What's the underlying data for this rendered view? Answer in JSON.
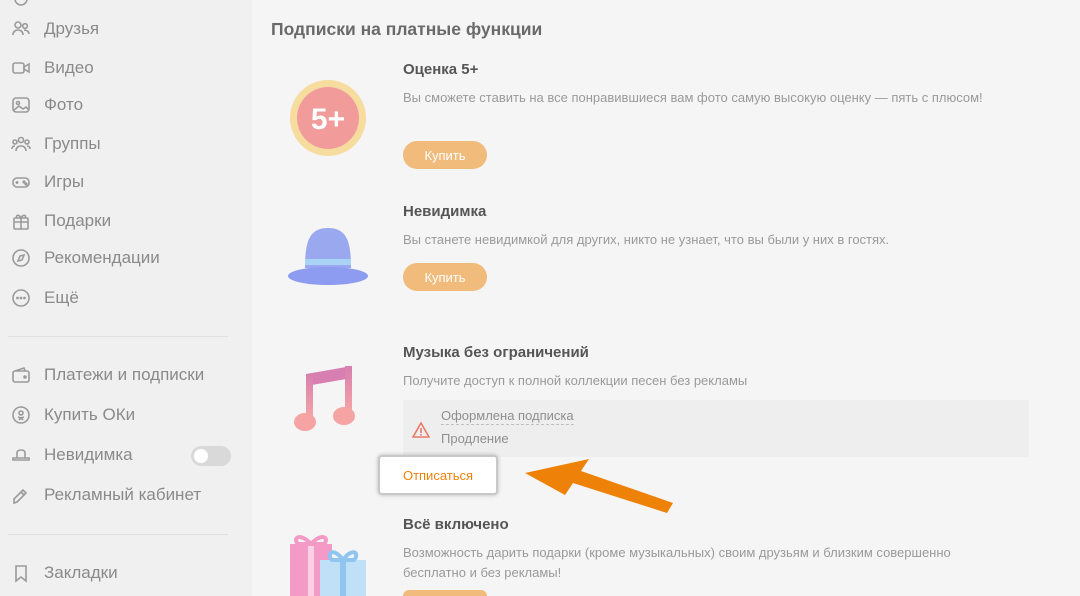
{
  "sidebar": {
    "items": [
      {
        "label": "Друзья",
        "icon": "friends-icon"
      },
      {
        "label": "Видео",
        "icon": "video-icon"
      },
      {
        "label": "Фото",
        "icon": "photo-icon"
      },
      {
        "label": "Группы",
        "icon": "groups-icon"
      },
      {
        "label": "Игры",
        "icon": "games-icon"
      },
      {
        "label": "Подарки",
        "icon": "gift-icon"
      },
      {
        "label": "Рекомендации",
        "icon": "compass-icon"
      },
      {
        "label": "Ещё",
        "icon": "more-icon"
      }
    ],
    "items2": [
      {
        "label": "Платежи и подписки",
        "icon": "wallet-icon"
      },
      {
        "label": "Купить ОКи",
        "icon": "ok-coin-icon"
      },
      {
        "label": "Невидимка",
        "icon": "hat-icon"
      },
      {
        "label": "Рекламный кабинет",
        "icon": "megaphone-icon"
      }
    ],
    "items3": [
      {
        "label": "Закладки",
        "icon": "bookmark-icon"
      }
    ],
    "invisible_toggle_on": false
  },
  "main": {
    "section_title": "Подписки на платные функции",
    "features": [
      {
        "title": "Оценка 5+",
        "badge": "5+",
        "description": "Вы сможете ставить на все понравившиеся вам фото самую высокую оценку — пять с плюсом!",
        "button": "Купить"
      },
      {
        "title": "Невидимка",
        "description": "Вы станете невидимкой для других, никто не узнает, что вы были у них в гостях.",
        "button": "Купить"
      },
      {
        "title": "Музыка без ограничений",
        "description": "Получите доступ к полной коллекции песен без рекламы",
        "subscription": {
          "status": "Оформлена подписка",
          "renewal": "Продление"
        },
        "unsubscribe": "Отписаться"
      },
      {
        "title": "Всё включено",
        "description": "Возможность дарить подарки (кроме музыкальных) своим друзьям и близким совершенно бесплатно и без рекламы!"
      }
    ]
  },
  "colors": {
    "accent": "#ee8208",
    "buy_button": "#f0bb7b",
    "arrow": "#ee8208"
  }
}
